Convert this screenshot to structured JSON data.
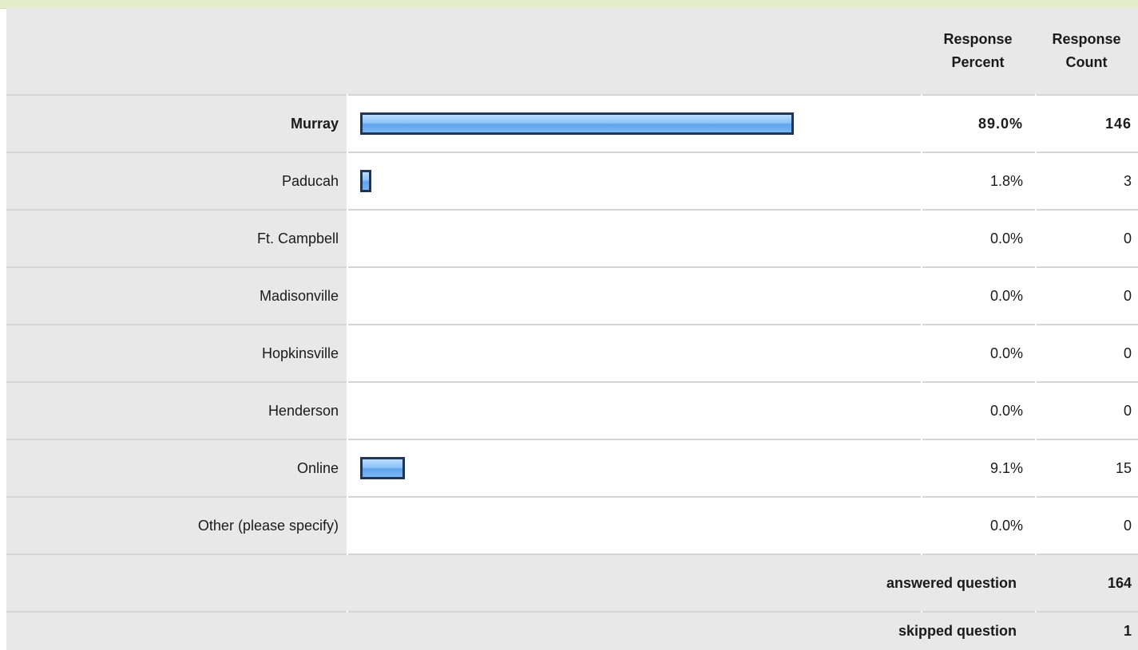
{
  "headers": {
    "percent": "Response\nPercent",
    "count": "Response\nCount"
  },
  "chart_data": {
    "type": "bar",
    "orientation": "horizontal",
    "categories": [
      "Murray",
      "Paducah",
      "Ft. Campbell",
      "Madisonville",
      "Hopkinsville",
      "Henderson",
      "Online",
      "Other (please specify)"
    ],
    "values": [
      89.0,
      1.8,
      0.0,
      0.0,
      0.0,
      0.0,
      9.1,
      0.0
    ],
    "percent_labels": [
      "89.0%",
      "1.8%",
      "0.0%",
      "0.0%",
      "0.0%",
      "0.0%",
      "9.1%",
      "0.0%"
    ],
    "counts": [
      "146",
      "3",
      "0",
      "0",
      "0",
      "0",
      "15",
      "0"
    ],
    "highlighted_index": 0,
    "bar_colors": {
      "fill": "#8cc2f8",
      "border": "#1f3657"
    }
  },
  "summary": {
    "answered_label": "answered question",
    "answered_value": "164",
    "skipped_label": "skipped question",
    "skipped_value": "1"
  }
}
